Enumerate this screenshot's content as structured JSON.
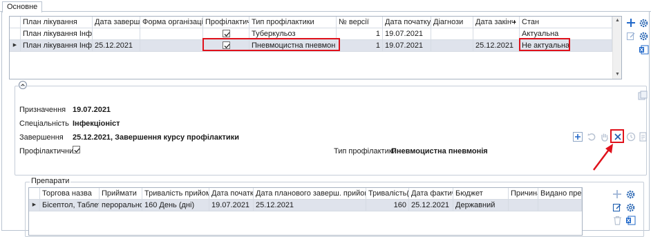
{
  "tab": {
    "label": "Основне"
  },
  "plans_grid": {
    "columns": [
      "План лікування",
      "Дата завершен",
      "Форма організації лі",
      "Профілактичні",
      "Тип профілактики",
      "№ версії",
      "Дата початку в",
      "Діагнози",
      "Дата закінч",
      "Стан"
    ],
    "rows": [
      {
        "plan": "План лікування Інфек...",
        "end_date": "",
        "org_form": "",
        "prophylactic": true,
        "type": "Туберкульоз",
        "version": "1",
        "start_date": "19.07.2021",
        "diagnoses": "",
        "finish_date": "",
        "status": "Актуальна"
      },
      {
        "plan": "План лікування Інфек...",
        "end_date": "25.12.2021",
        "org_form": "",
        "prophylactic": true,
        "type": "Пневмоцистна пневмонія",
        "version": "1",
        "start_date": "19.07.2021",
        "diagnoses": "",
        "finish_date": "25.12.2021",
        "status": "Не актуальна"
      }
    ],
    "selected_row": 1,
    "sort_column": "Дата закінч",
    "sort_direction": "ascending"
  },
  "details": {
    "assignment_label": "Призначення",
    "assignment_value": "19.07.2021",
    "specialty_label": "Спеціальність",
    "specialty_value": "Інфекціоніст",
    "completion_label": "Завершення",
    "completion_value": "25.12.2021, Завершення курсу профілактики",
    "prophylactic_label": "Профілактичний",
    "prophylactic_checked": true,
    "prophylaxis_type_label": "Тип профілактики",
    "prophylaxis_type_value": "Пневмоцистна пневмонія"
  },
  "drugs": {
    "group_title": "Препарати",
    "columns": [
      "Торгова назва",
      "Приймати",
      "Тривалість прийому",
      "Дата початку",
      "Дата планового заверш. прийому",
      "Тривалість(фа",
      "Дата фактичн",
      "Бюджет",
      "Причина при",
      "Видано препа"
    ],
    "rows": [
      {
        "trade_name": "Бісептол, Таблет...",
        "take": "перорально...",
        "duration": "160 День (дні)",
        "start_date": "19.07.2021",
        "planned_end": "25.12.2021",
        "actual_duration": "160",
        "actual_date": "25.12.2021",
        "budget": "Державний",
        "reason": "",
        "issued": ""
      }
    ]
  },
  "colors": {
    "highlight": "#e0111b",
    "selection": "#dfe3ec",
    "accent_blue": "#1f67c9"
  }
}
